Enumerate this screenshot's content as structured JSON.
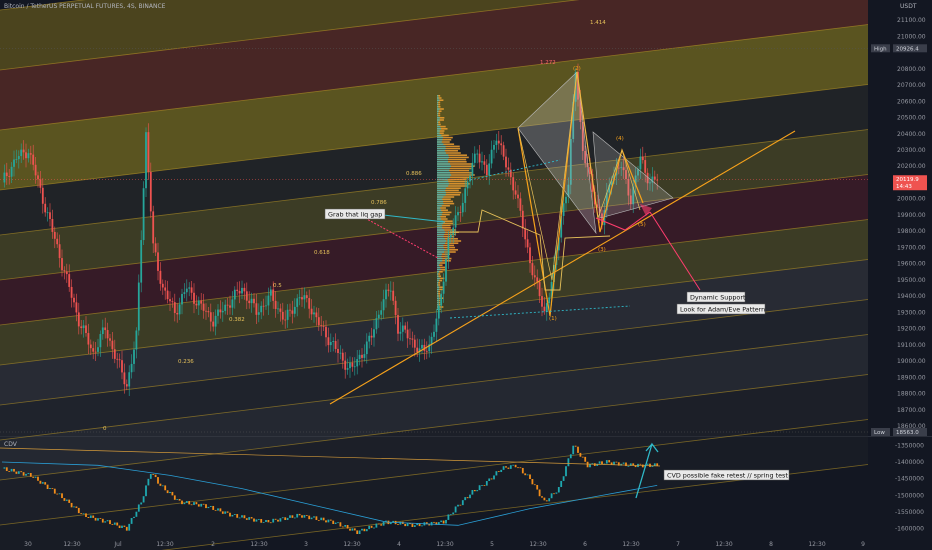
{
  "header": {
    "title": "Bitcoin / TetherUS PERPETUAL FUTURES, 4S, BINANCE",
    "currency": "USDT"
  },
  "price_scale": {
    "labels": [
      "21100.00",
      "21000.00",
      "20800.00",
      "20700.00",
      "20600.00",
      "20500.00",
      "20400.00",
      "20300.00",
      "20200.00",
      "20100.00",
      "20000.00",
      "19900.00",
      "19800.00",
      "19700.00",
      "19600.00",
      "19500.00",
      "19400.00",
      "19300.00",
      "19200.00",
      "19100.00",
      "19000.00",
      "18900.00",
      "18800.00",
      "18700.00",
      "18600.00"
    ],
    "high_label": "High",
    "high_value": "20926.4",
    "low_label": "Low",
    "low_value": "18563.0",
    "last_price": "20119.9",
    "countdown": "14:43"
  },
  "time_axis": {
    "labels": [
      "30",
      "12:30",
      "Jul",
      "12:30",
      "2",
      "12:30",
      "3",
      "12:30",
      "4",
      "12:30",
      "5",
      "12:30",
      "6",
      "12:30",
      "7",
      "12:30",
      "8",
      "12:30",
      "9"
    ]
  },
  "fib_labels": [
    "1.414",
    "1.272",
    "0.886",
    "0.786",
    "0.618",
    "0.5",
    "0.382",
    "0.236",
    "0"
  ],
  "wave_labels": [
    "(1)",
    "(2)",
    "(3)",
    "(4)",
    "(5)"
  ],
  "annotations": {
    "liq_gap": "Grab that liq gap",
    "dynamic_support": "Dynamic Support",
    "adam_eve": "Look for Adam/Eve Pattern",
    "cvd_note": "CVD possible fake retest // spring test"
  },
  "cvd": {
    "title": "CDV",
    "scale_labels": [
      "-1350000",
      "-1400000",
      "-1450000",
      "-1500000",
      "-1550000",
      "-1600000"
    ]
  },
  "colors": {
    "bull": "#26a69a",
    "bear": "#ef5350",
    "fib_gold": "#c9a227",
    "trend": "#f7a21b",
    "accent_cyan": "#2fb9c9",
    "pink": "#ff3d6e",
    "cvd_up": "#1fa8b0",
    "cvd_down": "#f28d1a"
  },
  "chart_data": {
    "type": "candlestick",
    "title": "Bitcoin / TetherUS PERPETUAL FUTURES, 4S, BINANCE",
    "x_labels": [
      "30",
      "12:30",
      "Jul",
      "12:30",
      "2",
      "12:30",
      "3",
      "12:30",
      "4",
      "12:30",
      "5",
      "12:30",
      "6",
      "12:30",
      "7",
      "12:30",
      "8",
      "12:30",
      "9"
    ],
    "ylim": [
      18563,
      21150
    ],
    "price_path": [
      [
        0,
        20100
      ],
      [
        6,
        20250
      ],
      [
        11,
        20300
      ],
      [
        16,
        20050
      ],
      [
        22,
        19750
      ],
      [
        27,
        19500
      ],
      [
        32,
        19250
      ],
      [
        38,
        19050
      ],
      [
        43,
        19200
      ],
      [
        48,
        19000
      ],
      [
        52,
        18850
      ],
      [
        56,
        19150
      ],
      [
        60,
        20400
      ],
      [
        63,
        19700
      ],
      [
        67,
        19450
      ],
      [
        72,
        19300
      ],
      [
        77,
        19450
      ],
      [
        82,
        19350
      ],
      [
        88,
        19250
      ],
      [
        94,
        19350
      ],
      [
        100,
        19450
      ],
      [
        106,
        19300
      ],
      [
        112,
        19400
      ],
      [
        118,
        19250
      ],
      [
        124,
        19400
      ],
      [
        128,
        19350
      ],
      [
        133,
        19200
      ],
      [
        138,
        19100
      ],
      [
        142,
        19000
      ],
      [
        146,
        18950
      ],
      [
        150,
        19050
      ],
      [
        154,
        19150
      ],
      [
        158,
        19350
      ],
      [
        162,
        19450
      ],
      [
        165,
        19200
      ],
      [
        170,
        19150
      ],
      [
        174,
        19050
      ],
      [
        178,
        19100
      ],
      [
        182,
        19300
      ],
      [
        186,
        19750
      ],
      [
        190,
        19900
      ],
      [
        194,
        20100
      ],
      [
        198,
        20300
      ],
      [
        202,
        20150
      ],
      [
        206,
        20400
      ],
      [
        210,
        20200
      ],
      [
        214,
        20050
      ],
      [
        218,
        19750
      ],
      [
        222,
        19500
      ],
      [
        226,
        19300
      ],
      [
        230,
        19550
      ],
      [
        233,
        19900
      ],
      [
        236,
        20100
      ],
      [
        239,
        20800
      ],
      [
        242,
        20300
      ],
      [
        246,
        20050
      ],
      [
        250,
        19850
      ],
      [
        254,
        20150
      ],
      [
        258,
        20200
      ],
      [
        262,
        20000
      ],
      [
        266,
        20250
      ],
      [
        270,
        20100
      ],
      [
        273,
        20120
      ]
    ],
    "cvd": {
      "ylim": [
        -1625000,
        -1325000
      ],
      "path": [
        [
          0,
          -1420000
        ],
        [
          12,
          -1440000
        ],
        [
          24,
          -1500000
        ],
        [
          34,
          -1560000
        ],
        [
          44,
          -1580000
        ],
        [
          52,
          -1600000
        ],
        [
          58,
          -1520000
        ],
        [
          62,
          -1430000
        ],
        [
          66,
          -1470000
        ],
        [
          74,
          -1520000
        ],
        [
          84,
          -1530000
        ],
        [
          96,
          -1560000
        ],
        [
          110,
          -1580000
        ],
        [
          124,
          -1560000
        ],
        [
          138,
          -1580000
        ],
        [
          148,
          -1610000
        ],
        [
          160,
          -1580000
        ],
        [
          172,
          -1590000
        ],
        [
          184,
          -1580000
        ],
        [
          190,
          -1530000
        ],
        [
          196,
          -1490000
        ],
        [
          202,
          -1460000
        ],
        [
          208,
          -1420000
        ],
        [
          214,
          -1410000
        ],
        [
          220,
          -1450000
        ],
        [
          226,
          -1520000
        ],
        [
          232,
          -1480000
        ],
        [
          238,
          -1350000
        ],
        [
          244,
          -1410000
        ],
        [
          252,
          -1400000
        ],
        [
          262,
          -1410000
        ],
        [
          273,
          -1410000
        ]
      ],
      "ma": [
        [
          0,
          -1400000
        ],
        [
          40,
          -1410000
        ],
        [
          70,
          -1440000
        ],
        [
          100,
          -1480000
        ],
        [
          130,
          -1530000
        ],
        [
          160,
          -1580000
        ],
        [
          190,
          -1590000
        ],
        [
          220,
          -1540000
        ],
        [
          250,
          -1500000
        ],
        [
          273,
          -1470000
        ]
      ]
    }
  }
}
